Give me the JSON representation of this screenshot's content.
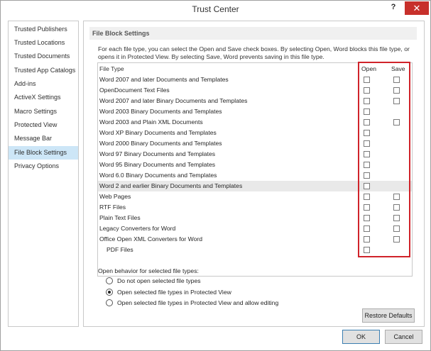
{
  "window": {
    "title": "Trust Center",
    "help_glyph": "?",
    "close_glyph": "✕"
  },
  "sidebar": {
    "items": [
      {
        "label": "Trusted Publishers"
      },
      {
        "label": "Trusted Locations"
      },
      {
        "label": "Trusted Documents"
      },
      {
        "label": "Trusted App Catalogs"
      },
      {
        "label": "Add-ins"
      },
      {
        "label": "ActiveX Settings"
      },
      {
        "label": "Macro Settings"
      },
      {
        "label": "Protected View"
      },
      {
        "label": "Message Bar"
      },
      {
        "label": "File Block Settings"
      },
      {
        "label": "Privacy Options"
      }
    ],
    "selected": "File Block Settings"
  },
  "main": {
    "section_title": "File Block Settings",
    "description_line1": "For each file type, you can select the Open and Save check boxes. By selecting Open, Word blocks this file type, or",
    "description_line2": "opens it in Protected View. By selecting Save, Word prevents saving in this file type.",
    "table": {
      "headers": {
        "file_type": "File Type",
        "open": "Open",
        "save": "Save"
      },
      "rows": [
        {
          "label": "Word 2007 and later Documents and Templates",
          "open": false,
          "save": false
        },
        {
          "label": "OpenDocument Text Files",
          "open": false,
          "save": false
        },
        {
          "label": "Word 2007 and later Binary Documents and Templates",
          "open": false,
          "save": false
        },
        {
          "label": "Word 2003 Binary Documents and Templates",
          "open": false
        },
        {
          "label": "Word 2003 and Plain XML Documents",
          "open": false,
          "save": false
        },
        {
          "label": "Word XP Binary Documents and Templates",
          "open": false
        },
        {
          "label": "Word 2000 Binary Documents and Templates",
          "open": false
        },
        {
          "label": "Word 97 Binary Documents and Templates",
          "open": false
        },
        {
          "label": "Word 95 Binary Documents and Templates",
          "open": false
        },
        {
          "label": "Word 6.0 Binary Documents and Templates",
          "open": false
        },
        {
          "label": "Word 2 and earlier Binary Documents and Templates",
          "open": false,
          "highlighted": true
        },
        {
          "label": "Web Pages",
          "open": false,
          "save": false
        },
        {
          "label": "RTF Files",
          "open": false,
          "save": false
        },
        {
          "label": "Plain Text Files",
          "open": false,
          "save": false
        },
        {
          "label": "Legacy Converters for Word",
          "open": false,
          "save": false
        },
        {
          "label": "Office Open XML Converters for Word",
          "open": false,
          "save": false
        },
        {
          "label": "PDF Files",
          "open": false,
          "indent": true
        }
      ]
    },
    "open_behavior": {
      "label": "Open behavior for selected file types:",
      "options": [
        {
          "label": "Do not open selected file types",
          "selected": false
        },
        {
          "label": "Open selected file types in Protected View",
          "selected": true
        },
        {
          "label": "Open selected file types in Protected View and allow editing",
          "selected": false
        }
      ]
    },
    "restore_button": "Restore Defaults"
  },
  "footer": {
    "ok": "OK",
    "cancel": "Cancel"
  },
  "colors": {
    "selection": "#cde6f7",
    "highlight_box": "#d0232a",
    "close_button": "#c7302b"
  }
}
